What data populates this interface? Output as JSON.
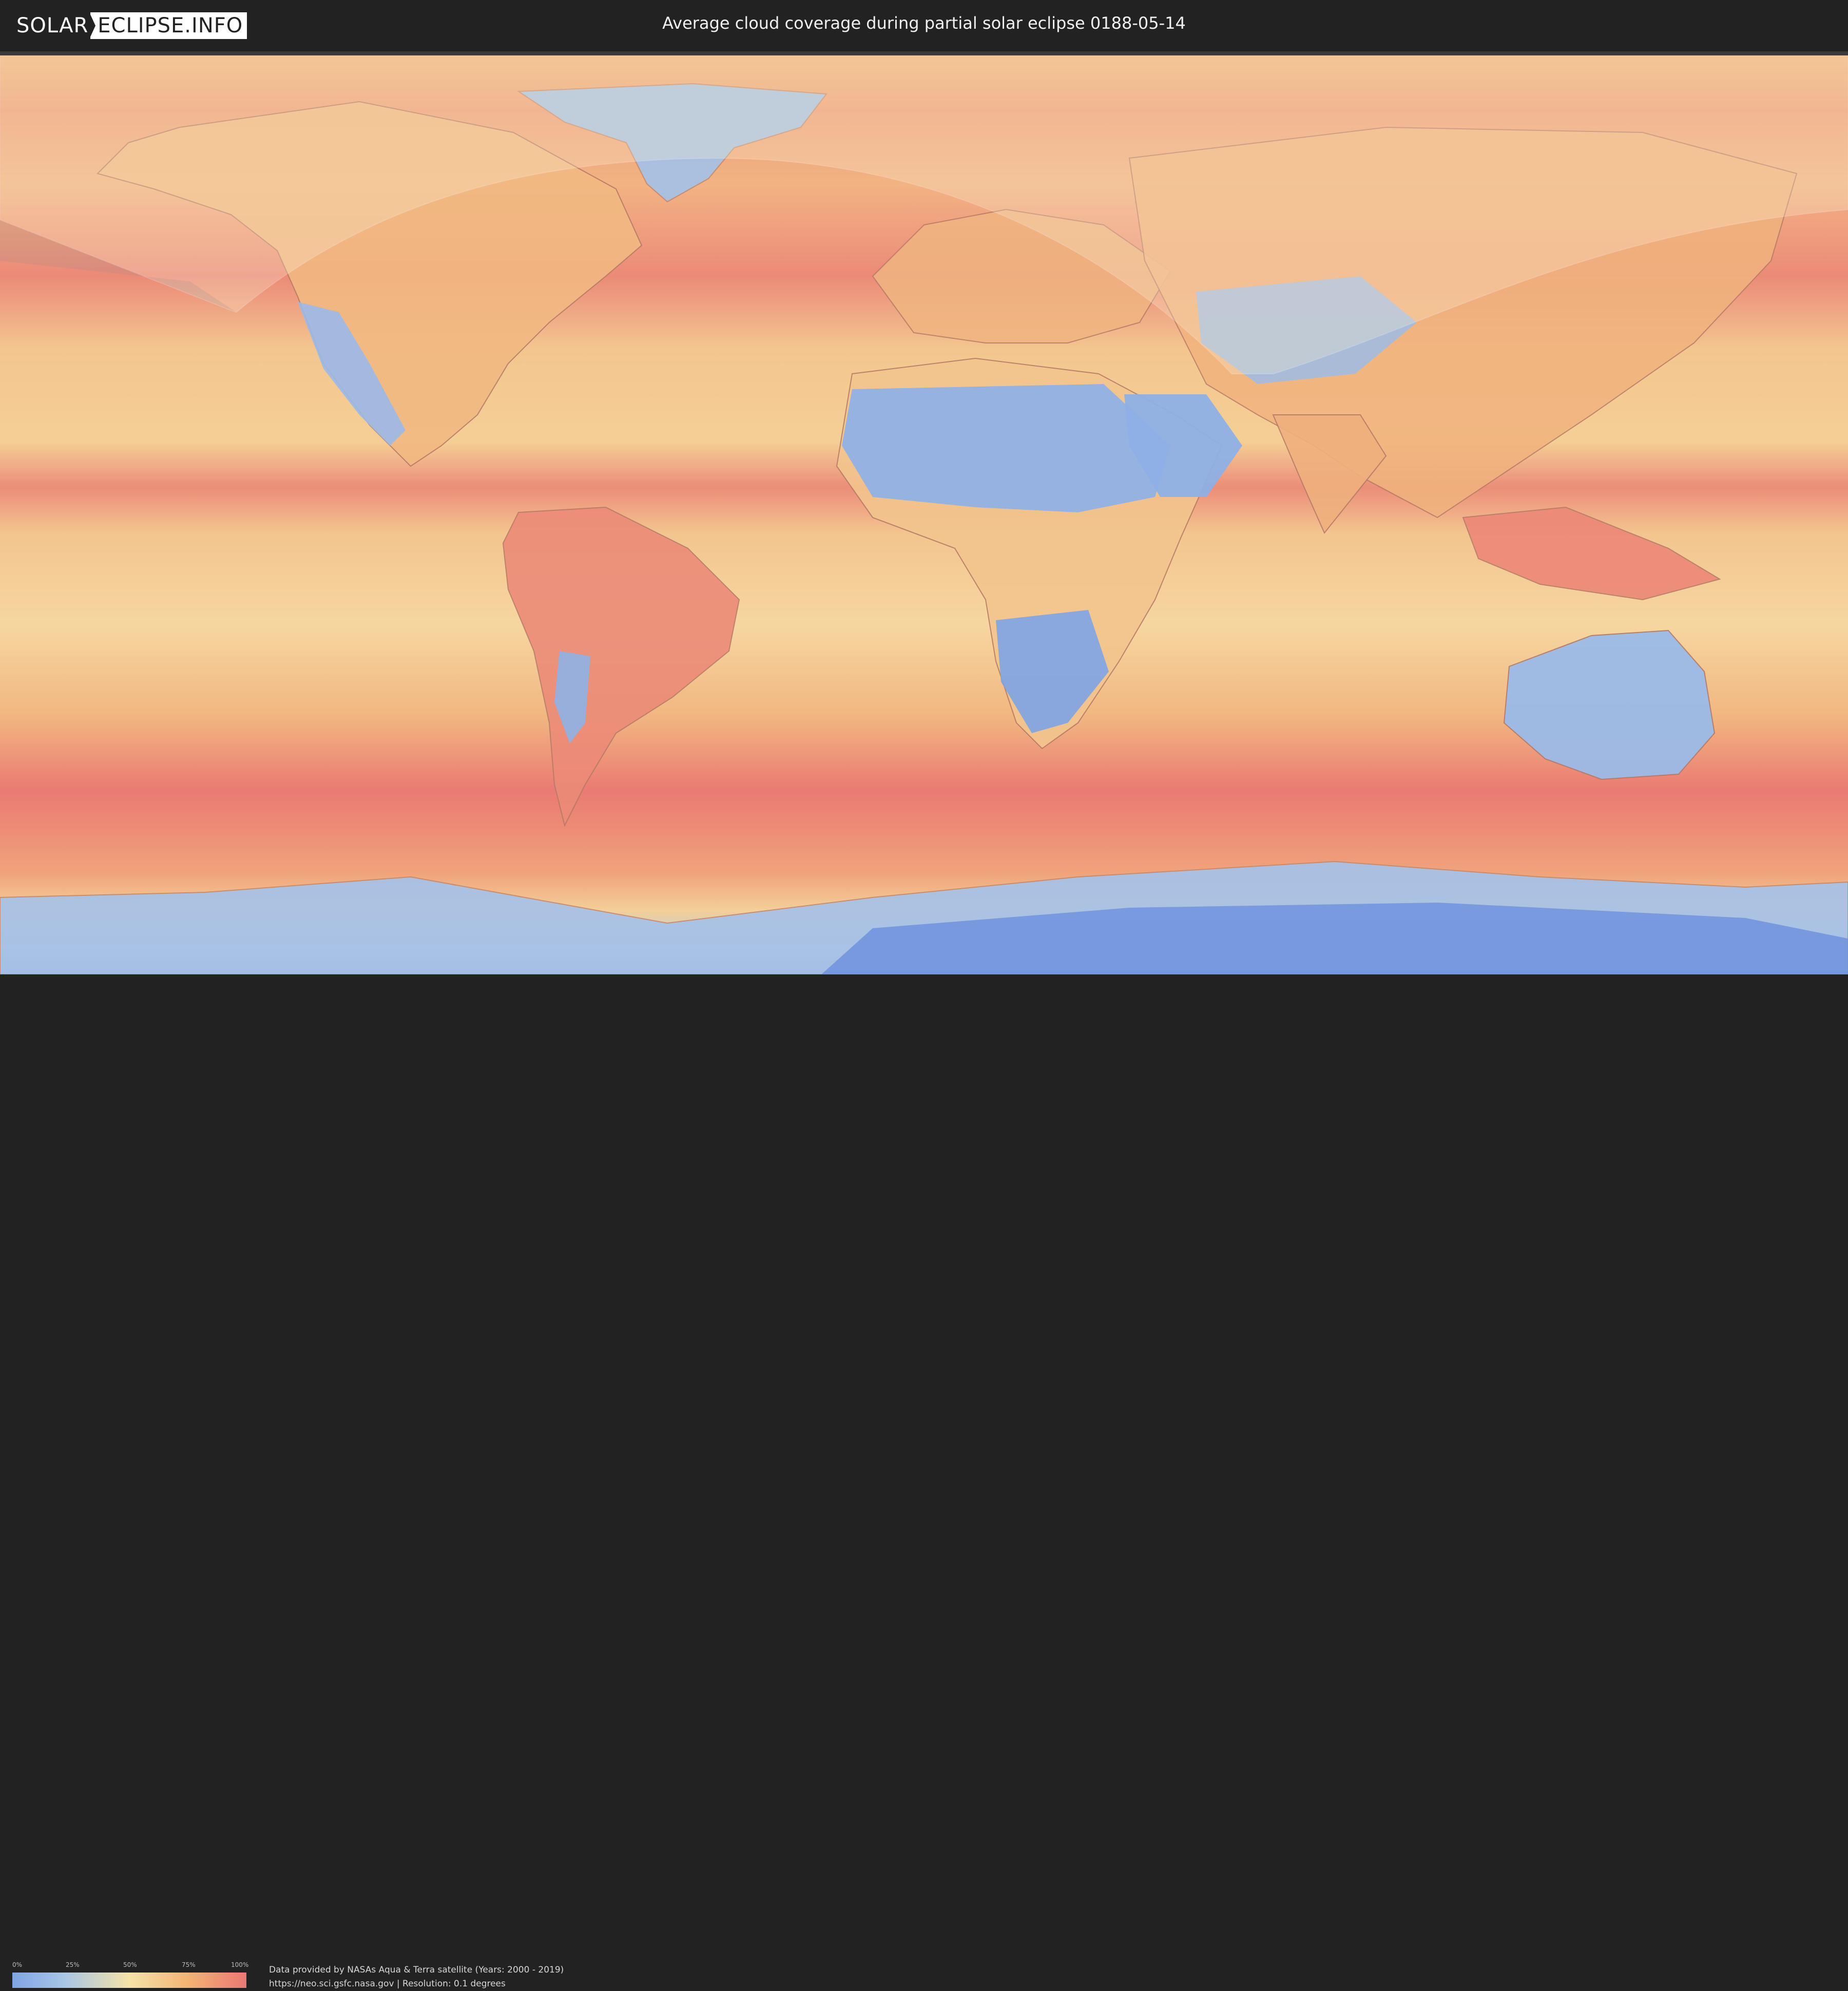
{
  "header": {
    "logo_part1": "SOLAR",
    "logo_part2": "ECLIPSE.INFO",
    "title": "Average cloud coverage during partial solar eclipse 0188-05-14"
  },
  "legend": {
    "labels": [
      "0%",
      "25%",
      "50%",
      "75%",
      "100%"
    ],
    "colors": [
      "#7fa4e6",
      "#a8c6e6",
      "#f5e3a8",
      "#f3b474",
      "#ea7873"
    ]
  },
  "footer": {
    "credit_line1": "Data provided by NASAs Aqua & Terra satellite (Years: 2000 - 2019)",
    "credit_line2": "https://neo.sci.gsfc.nasa.gov | Resolution: 0.1 degrees"
  },
  "map": {
    "projection": "equirectangular",
    "layer": "cloud coverage",
    "overlay": "partial eclipse visibility region",
    "colors": {
      "cloudy": "#ea7873",
      "medium": "#f3c48a",
      "clear": "#8fb2e6",
      "polar_blue": "#5577d6"
    }
  }
}
